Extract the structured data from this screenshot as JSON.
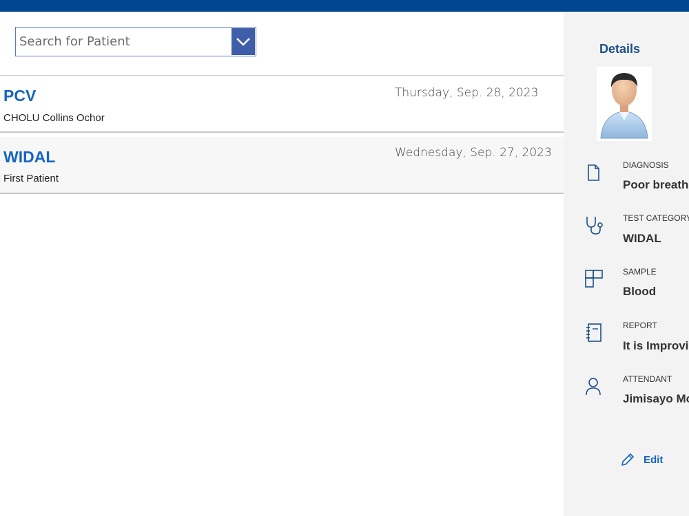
{
  "search": {
    "placeholder": "Search for Patient",
    "value": ""
  },
  "records": [
    {
      "test": "PCV",
      "patient": "CHOLU Collins Ochor",
      "date": "Thursday, Sep. 28, 2023"
    },
    {
      "test": "WIDAL",
      "patient": "First Patient",
      "date": "Wednesday, Sep. 27, 2023"
    }
  ],
  "details": {
    "heading": "Details",
    "fields": [
      {
        "label": "DIAGNOSIS",
        "value": "Poor breath c",
        "icon": "document-icon"
      },
      {
        "label": "TEST CATEGORY",
        "value": "WIDAL",
        "icon": "stethoscope-icon"
      },
      {
        "label": "SAMPLE",
        "value": "Blood",
        "icon": "grid-icon"
      },
      {
        "label": "REPORT",
        "value": "It is Improvin",
        "icon": "notebook-icon"
      },
      {
        "label": "ATTENDANT",
        "value": "Jimisayo Mor",
        "icon": "person-icon"
      }
    ],
    "edit_label": "Edit"
  },
  "colors": {
    "topbar": "#004590",
    "accent": "#1565c0",
    "dropdown": "#3f5ea8",
    "panel": "#f3f3f3"
  }
}
